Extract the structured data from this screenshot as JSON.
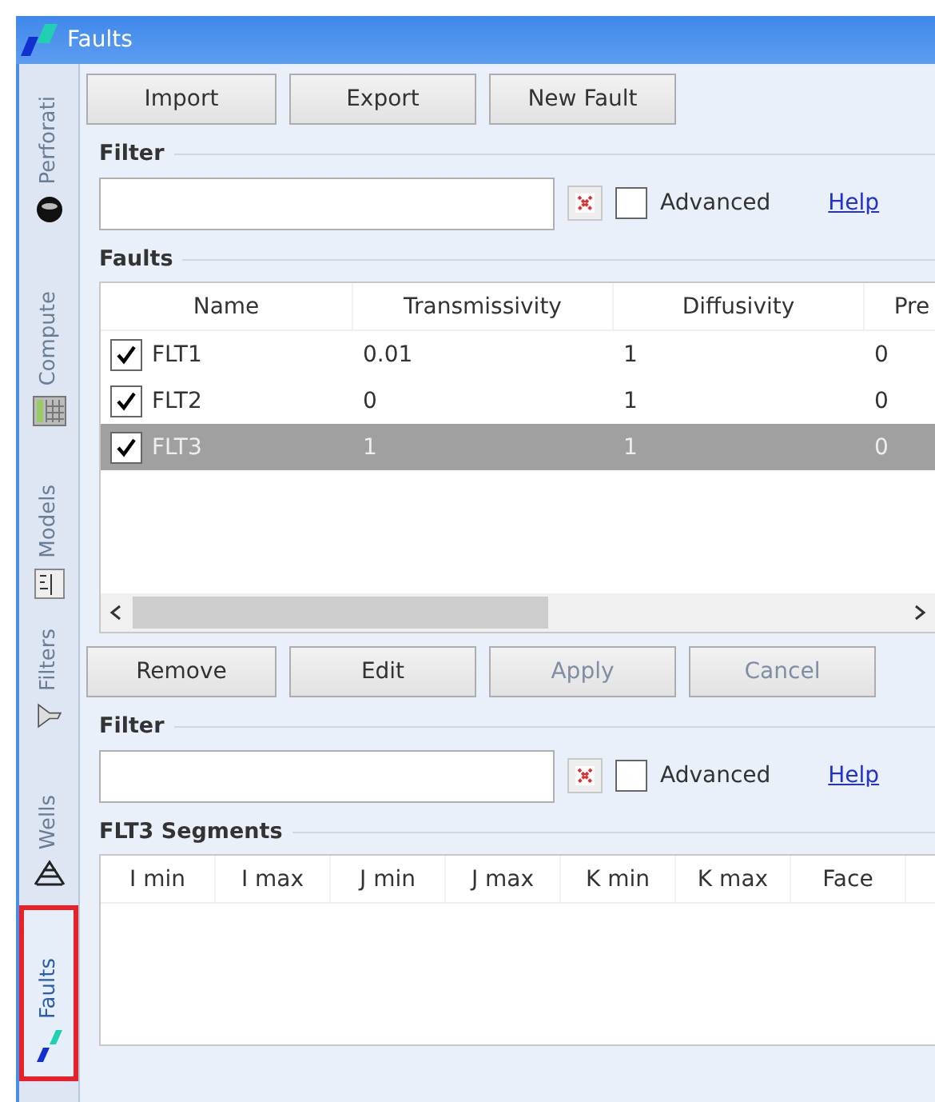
{
  "window": {
    "title": "Faults"
  },
  "side_tabs": [
    {
      "label": "Perforati",
      "selected": false
    },
    {
      "label": "Compute",
      "selected": false
    },
    {
      "label": "Models",
      "selected": false
    },
    {
      "label": "Filters",
      "selected": false
    },
    {
      "label": "Wells",
      "selected": false
    },
    {
      "label": "Faults",
      "selected": true
    }
  ],
  "toolbar": [
    {
      "label": "Import",
      "disabled": false
    },
    {
      "label": "Export",
      "disabled": false
    },
    {
      "label": "New Fault",
      "disabled": false
    }
  ],
  "filter": {
    "title": "Filter",
    "advanced_label": "Advanced",
    "advanced_checked": false,
    "help": "Help"
  },
  "faults": {
    "title": "Faults",
    "columns": [
      "Name",
      "Transmissivity",
      "Diffusivity",
      "Pre"
    ],
    "rows": [
      {
        "checked": true,
        "selected": false,
        "cells": [
          "FLT1",
          "0.01",
          "1",
          "0"
        ]
      },
      {
        "checked": true,
        "selected": false,
        "cells": [
          "FLT2",
          "0",
          "1",
          "0"
        ]
      },
      {
        "checked": true,
        "selected": true,
        "cells": [
          "FLT3",
          "1",
          "1",
          "0"
        ]
      }
    ]
  },
  "actions": [
    {
      "label": "Remove",
      "disabled": false
    },
    {
      "label": "Edit",
      "disabled": false
    },
    {
      "label": "Apply",
      "disabled": true
    },
    {
      "label": "Cancel",
      "disabled": true
    }
  ],
  "segment_filter": {
    "title": "Filter",
    "advanced_label": "Advanced",
    "advanced_checked": false,
    "help": "Help"
  },
  "segments": {
    "title": "FLT3 Segments",
    "columns": [
      "I min",
      "I max",
      "J min",
      "J max",
      "K min",
      "K max",
      "Face"
    ]
  }
}
